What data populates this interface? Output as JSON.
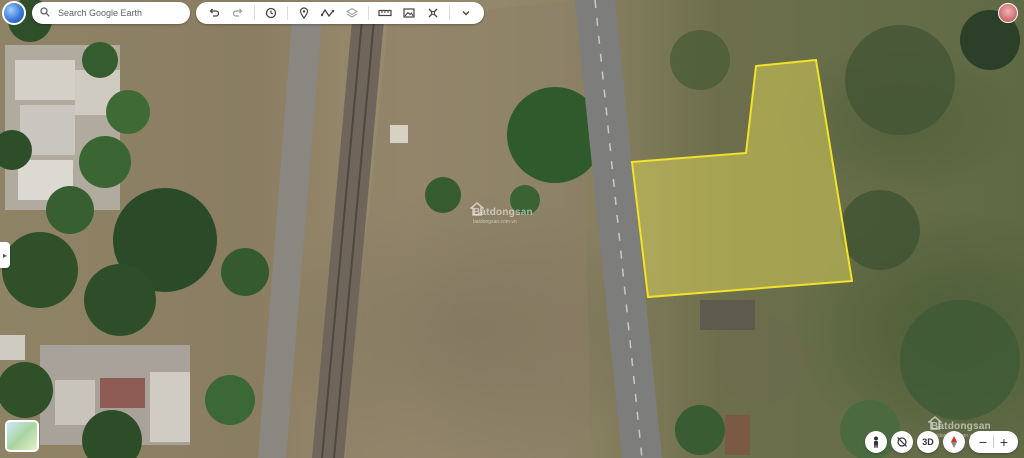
{
  "search": {
    "placeholder": "Search Google Earth"
  },
  "toolbar": {
    "icons": [
      "undo-icon",
      "redo-icon",
      "history-icon",
      "placemark-icon",
      "path-icon",
      "layers-icon",
      "measure-icon",
      "photo-icon",
      "mapstyle-icon",
      "chevron-down-icon"
    ]
  },
  "watermark": {
    "brand": "Batdongsan",
    "sub": "batdongsan.com.vn"
  },
  "bottom_controls": {
    "view_3d_label": "3D"
  },
  "colors": {
    "boundary": "#f2e22a",
    "road": "#7b7b7b",
    "accent": "#1a73e8"
  }
}
